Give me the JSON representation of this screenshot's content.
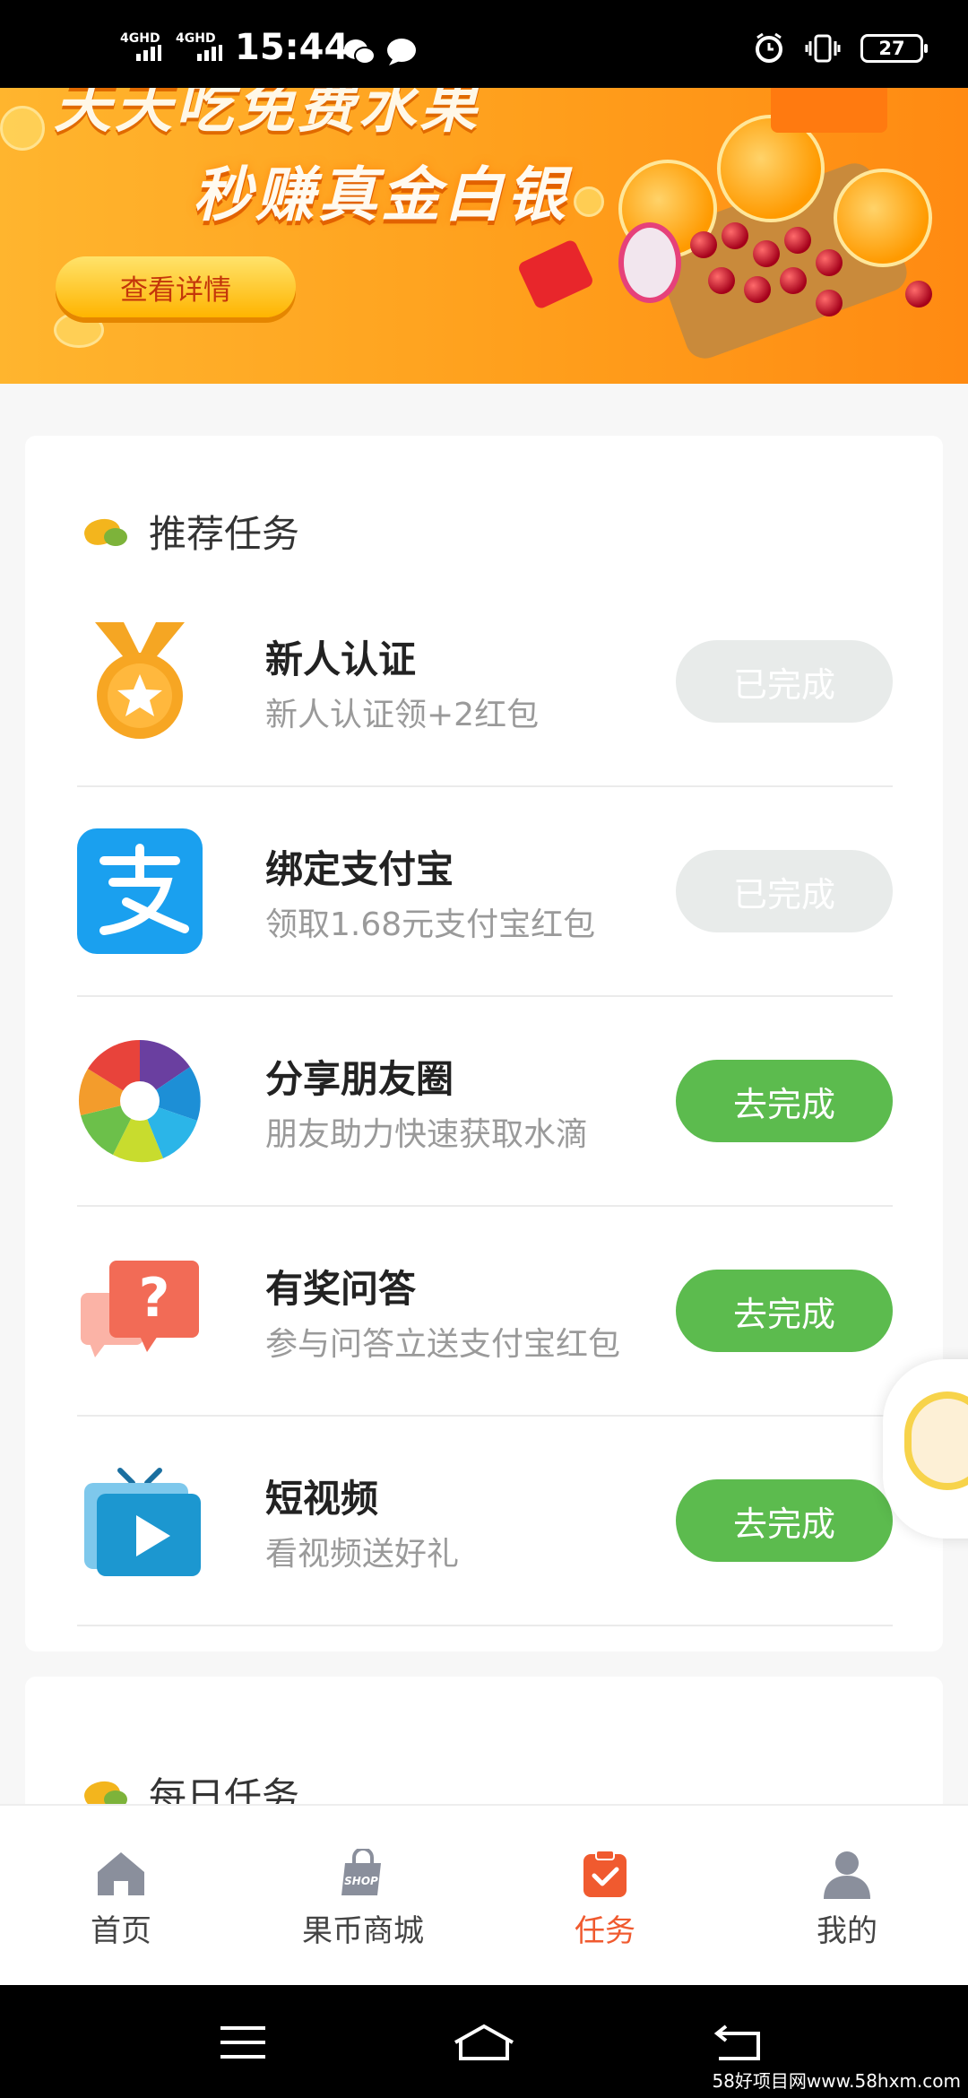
{
  "status_bar": {
    "network_1": "4GHD",
    "network_2": "4GHD",
    "time": "15:44",
    "battery": "27"
  },
  "banner": {
    "line1": "天天吃免费水果",
    "line2": "秒赚真金白银",
    "button_label": "查看详情"
  },
  "recommended": {
    "title": "推荐任务",
    "tasks": [
      {
        "title": "新人认证",
        "desc": "新人认证领+2红包",
        "button": "已完成",
        "state": "done",
        "icon": "medal-icon"
      },
      {
        "title": "绑定支付宝",
        "desc": "领取1.68元支付宝红包",
        "button": "已完成",
        "state": "done",
        "icon": "alipay-icon"
      },
      {
        "title": "分享朋友圈",
        "desc": "朋友助力快速获取水滴",
        "button": "去完成",
        "state": "todo",
        "icon": "moments-icon"
      },
      {
        "title": "有奖问答",
        "desc": "参与问答立送支付宝红包",
        "button": "去完成",
        "state": "todo",
        "icon": "question-chat-icon"
      },
      {
        "title": "短视频",
        "desc": "看视频送好礼",
        "button": "去完成",
        "state": "todo",
        "icon": "tv-play-icon"
      }
    ]
  },
  "daily": {
    "title": "每日任务"
  },
  "bottom_nav": {
    "items": [
      {
        "label": "首页",
        "icon": "home-icon",
        "active": false
      },
      {
        "label": "果币商城",
        "icon": "shop-bag-icon",
        "shop_text": "SHOP",
        "active": false
      },
      {
        "label": "任务",
        "icon": "task-clipboard-icon",
        "active": true
      },
      {
        "label": "我的",
        "icon": "user-icon",
        "active": false
      }
    ]
  },
  "watermark": "58好项目网www.58hxm.com",
  "colors": {
    "accent_green": "#5cbb4e",
    "active_tab": "#f05a2f",
    "banner_orange": "#ff9f1c"
  }
}
